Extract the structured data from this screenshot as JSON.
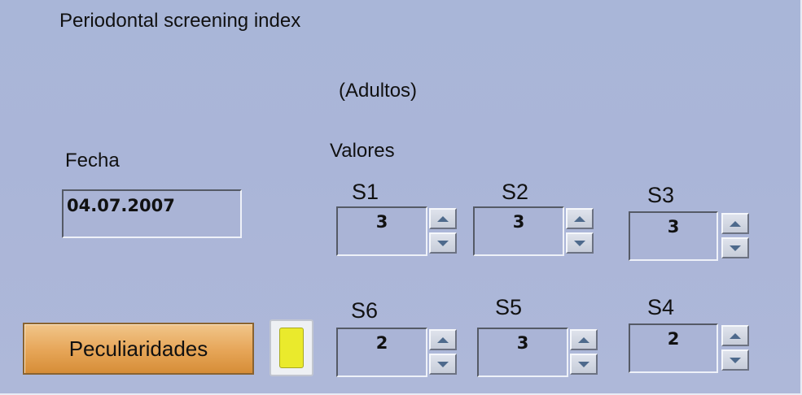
{
  "window": {
    "title": "Periodontal screening index",
    "subtitle": "(Adultos)"
  },
  "fecha": {
    "label": "Fecha",
    "value": "04.07.2007"
  },
  "valores": {
    "label": "Valores",
    "segments": {
      "s1": {
        "label": "S1",
        "value": "3"
      },
      "s2": {
        "label": "S2",
        "value": "3"
      },
      "s3": {
        "label": "S3",
        "value": "3"
      },
      "s6": {
        "label": "S6",
        "value": "2"
      },
      "s5": {
        "label": "S5",
        "value": "3"
      },
      "s4": {
        "label": "S4",
        "value": "2"
      }
    }
  },
  "actions": {
    "peculiaridades_label": "Peculiaridades",
    "note_icon": "sticky-note-icon"
  },
  "colors": {
    "background": "#aab5d8",
    "button_orange": "#e6a557",
    "note_yellow": "#eaea2c"
  }
}
